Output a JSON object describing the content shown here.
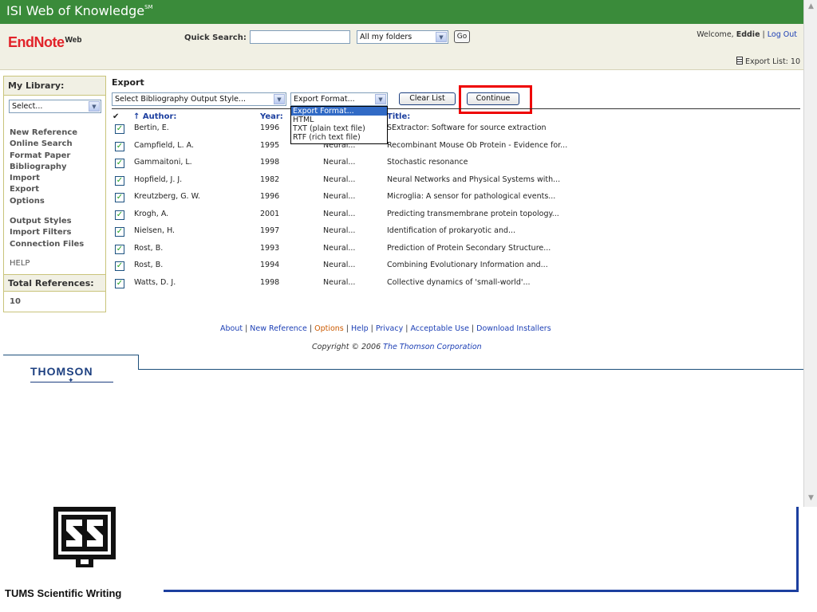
{
  "isi": {
    "title": "ISI Web of Knowledge",
    "sup": "SM"
  },
  "header": {
    "logo_main": "EndNote",
    "logo_web": "Web",
    "quick_search_label": "Quick Search:",
    "quick_search_value": "",
    "folder_select": "All my folders",
    "go_label": "Go",
    "welcome_prefix": "Welcome,",
    "welcome_user": "Eddie",
    "logout_label": "Log Out",
    "export_list_label": "Export List: 10"
  },
  "sidebar": {
    "title": "My Library:",
    "select_value": "Select...",
    "nav1": [
      "New Reference",
      "Online Search",
      "Format Paper",
      "Bibliography",
      "Import",
      "Export",
      "Options"
    ],
    "nav2": [
      "Output Styles",
      "Import Filters",
      "Connection Files"
    ],
    "help": "HELP",
    "total_label": "Total References:",
    "total_value": "10"
  },
  "export": {
    "title": "Export",
    "style_select": "Select Bibliography Output Style...",
    "format_select": "Export Format...",
    "clear_label": "Clear List",
    "continue_label": "Continue",
    "format_options": [
      "Export Format...",
      "HTML",
      "TXT (plain text file)",
      "RTF (rich text file)"
    ]
  },
  "table": {
    "check_head": "✔",
    "author_head": "↑ Author:",
    "year_head": "Year:",
    "title_head": "Title:",
    "rows": [
      {
        "author": "Bertin, E.",
        "year": "1996",
        "journal": "",
        "title": "SExtractor: Software for source extraction"
      },
      {
        "author": "Campfield, L. A.",
        "year": "1995",
        "journal": "Neural...",
        "title": "Recombinant Mouse Ob Protein - Evidence for..."
      },
      {
        "author": "Gammaitoni, L.",
        "year": "1998",
        "journal": "Neural...",
        "title": "Stochastic resonance"
      },
      {
        "author": "Hopfield, J. J.",
        "year": "1982",
        "journal": "Neural...",
        "title": "Neural Networks and Physical Systems with..."
      },
      {
        "author": "Kreutzberg, G. W.",
        "year": "1996",
        "journal": "Neural...",
        "title": "Microglia: A sensor for pathological events..."
      },
      {
        "author": "Krogh, A.",
        "year": "2001",
        "journal": "Neural...",
        "title": "Predicting transmembrane protein topology..."
      },
      {
        "author": "Nielsen, H.",
        "year": "1997",
        "journal": "Neural...",
        "title": "Identification of prokaryotic and..."
      },
      {
        "author": "Rost, B.",
        "year": "1993",
        "journal": "Neural...",
        "title": "Prediction of Protein Secondary Structure..."
      },
      {
        "author": "Rost, B.",
        "year": "1994",
        "journal": "Neural...",
        "title": "Combining Evolutionary Information and..."
      },
      {
        "author": "Watts, D. J.",
        "year": "1998",
        "journal": "Neural...",
        "title": "Collective dynamics of 'small-world'..."
      }
    ]
  },
  "footer": {
    "links": [
      "About",
      "New Reference",
      "Options",
      "Help",
      "Privacy",
      "Acceptable Use",
      "Download Installers"
    ],
    "copyright_prefix": "Copyright © 2006",
    "copyright_corp": "The Thomson Corporation",
    "thomson": "THOMSON"
  },
  "slide": {
    "caption": "TUMS Scientific Writing"
  },
  "colors": {
    "isi_green": "#3a8b3a",
    "header_beige": "#f1f0e4",
    "highlight_red": "#ee0000",
    "link_blue": "#1c3fb5",
    "slide_blue": "#1c3f9f"
  }
}
